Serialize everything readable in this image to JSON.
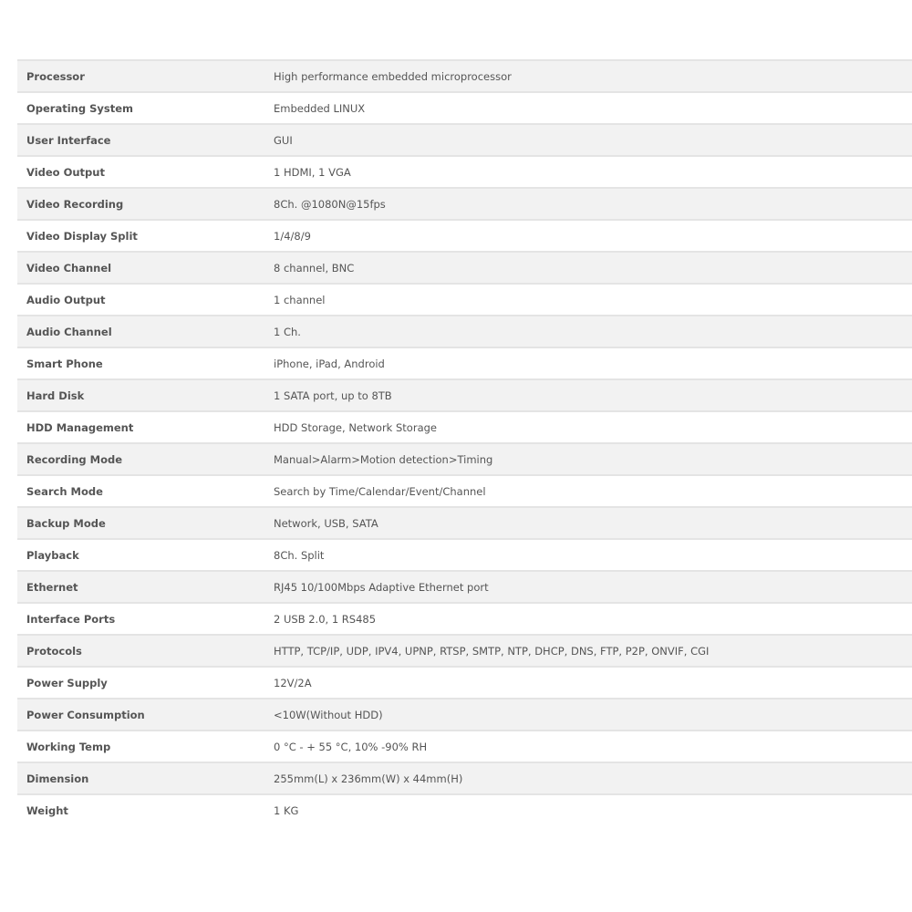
{
  "specs": [
    {
      "label": "Processor",
      "value": "High performance embedded microprocessor"
    },
    {
      "label": "Operating System",
      "value": "Embedded LINUX"
    },
    {
      "label": "User Interface",
      "value": "GUI"
    },
    {
      "label": "Video Output",
      "value": "1 HDMI, 1 VGA"
    },
    {
      "label": "Video Recording",
      "value": "8Ch. @1080N@15fps"
    },
    {
      "label": "Video Display Split",
      "value": "1/4/8/9"
    },
    {
      "label": "Video Channel",
      "value": "8 channel, BNC"
    },
    {
      "label": "Audio Output",
      "value": "1 channel"
    },
    {
      "label": "Audio Channel",
      "value": "1 Ch."
    },
    {
      "label": "Smart Phone",
      "value": "iPhone, iPad, Android"
    },
    {
      "label": "Hard Disk",
      "value": "1 SATA port, up to 8TB"
    },
    {
      "label": "HDD Management",
      "value": "HDD Storage, Network Storage"
    },
    {
      "label": "Recording Mode",
      "value": "Manual>Alarm>Motion detection>Timing"
    },
    {
      "label": "Search Mode",
      "value": "Search by Time/Calendar/Event/Channel"
    },
    {
      "label": "Backup Mode",
      "value": "Network, USB, SATA"
    },
    {
      "label": "Playback",
      "value": "8Ch. Split"
    },
    {
      "label": "Ethernet",
      "value": "RJ45 10/100Mbps Adaptive Ethernet port"
    },
    {
      "label": "Interface Ports",
      "value": "2 USB 2.0, 1 RS485"
    },
    {
      "label": "Protocols",
      "value": "HTTP, TCP/IP, UDP, IPV4, UPNP, RTSP, SMTP, NTP, DHCP, DNS, FTP, P2P, ONVIF, CGI"
    },
    {
      "label": "Power Supply",
      "value": "12V/2A"
    },
    {
      "label": "Power Consumption",
      "value": "<10W(Without HDD)"
    },
    {
      "label": "Working Temp",
      "value": "0 °C - + 55 °C, 10% -90% RH"
    },
    {
      "label": "Dimension",
      "value": "255mm(L) x 236mm(W) x 44mm(H)"
    },
    {
      "label": "Weight",
      "value": "1 KG"
    }
  ]
}
